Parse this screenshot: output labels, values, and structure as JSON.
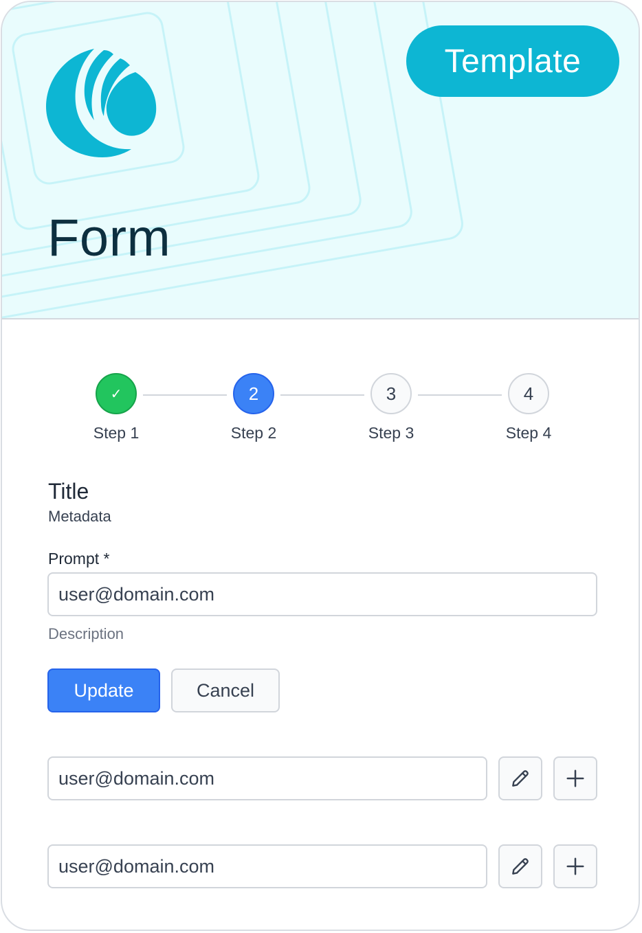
{
  "hero": {
    "badge_label": "Template",
    "title": "Form",
    "background_color": "#e9fcfd",
    "accent_color": "#0db6d3"
  },
  "stepper": {
    "steps": [
      {
        "marker": "✓",
        "label": "Step 1",
        "status": "complete"
      },
      {
        "marker": "2",
        "label": "Step 2",
        "status": "active"
      },
      {
        "marker": "3",
        "label": "Step 3",
        "status": "upcoming"
      },
      {
        "marker": "4",
        "label": "Step 4",
        "status": "upcoming"
      }
    ]
  },
  "section": {
    "title": "Title",
    "subtitle": "Metadata"
  },
  "form": {
    "prompt_label": "Prompt *",
    "prompt_value": "user@domain.com",
    "description": "Description",
    "update_label": "Update",
    "cancel_label": "Cancel"
  },
  "rows": [
    {
      "value": "user@domain.com",
      "edit_icon": "pencil-icon",
      "add_icon": "plus-icon"
    },
    {
      "value": "user@domain.com",
      "edit_icon": "pencil-icon",
      "add_icon": "plus-icon"
    }
  ],
  "colors": {
    "complete": "#22c55e",
    "active": "#3b82f6",
    "title_text": "#0d2f3f"
  }
}
